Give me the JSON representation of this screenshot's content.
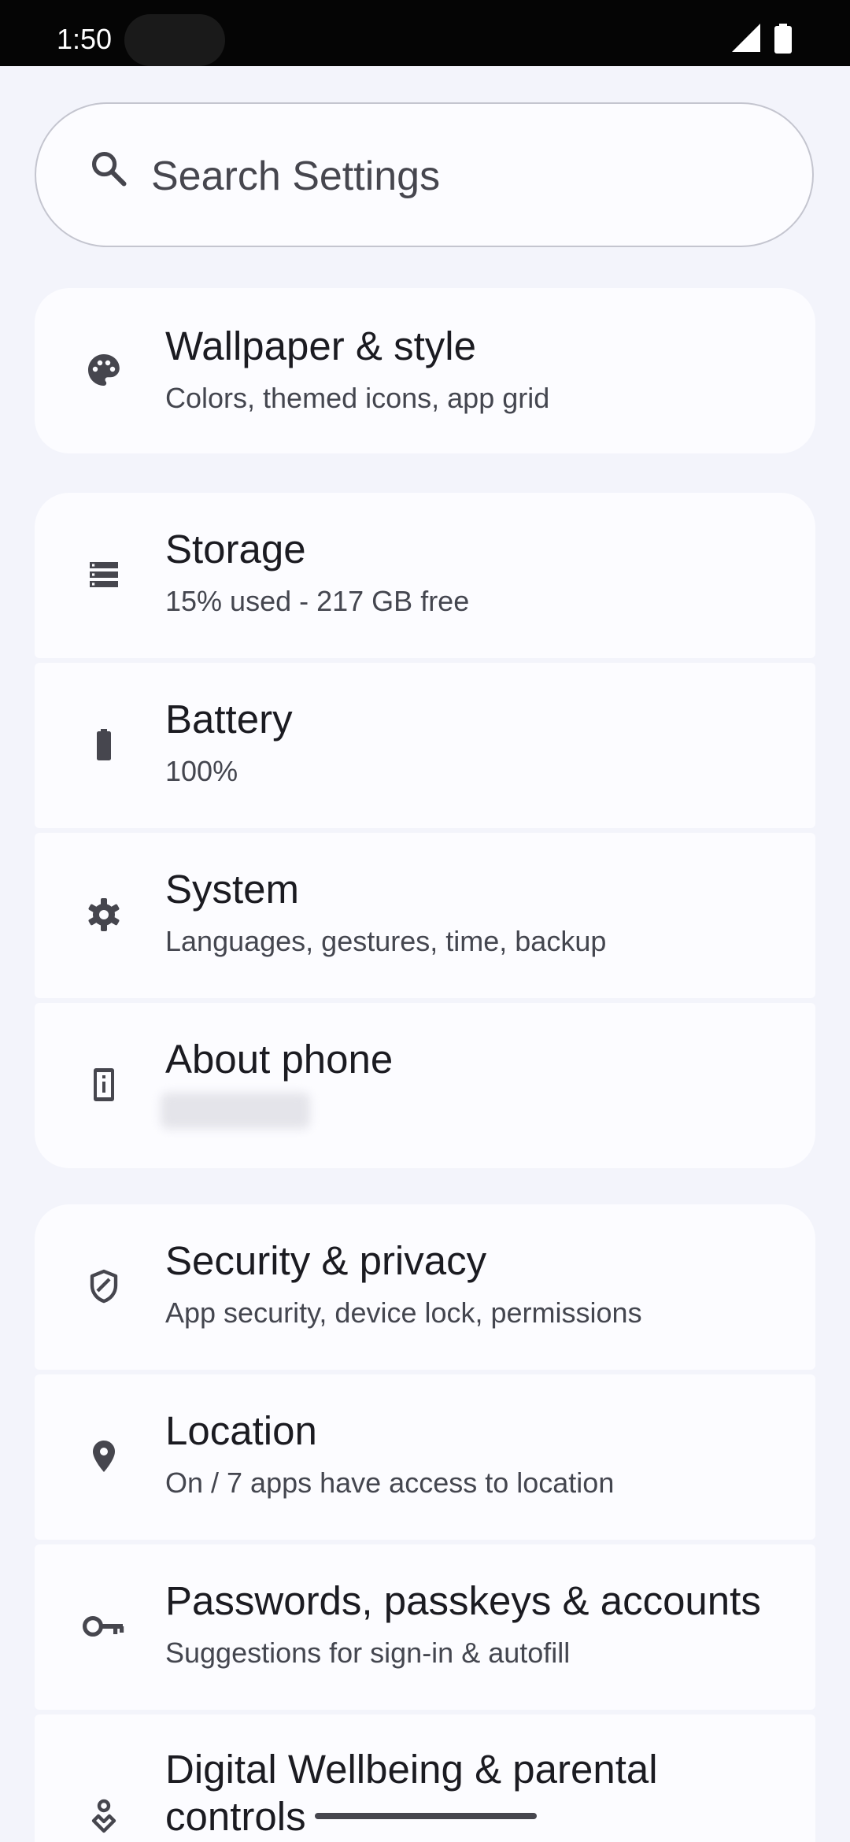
{
  "status_bar": {
    "time": "1:50",
    "icons": [
      "signal-icon",
      "battery-icon"
    ]
  },
  "search": {
    "placeholder": "Search Settings",
    "icon": "search-icon"
  },
  "items": [
    {
      "icon": "palette-icon",
      "title": "Wallpaper & style",
      "subtitle": "Colors, themed icons, app grid"
    },
    {
      "icon": "storage-icon",
      "title": "Storage",
      "subtitle": "15% used - 217 GB free"
    },
    {
      "icon": "battery-icon",
      "title": "Battery",
      "subtitle": "100%"
    },
    {
      "icon": "gear-icon",
      "title": "System",
      "subtitle": "Languages, gestures, time, backup"
    },
    {
      "icon": "phone-info-icon",
      "title": "About phone",
      "subtitle": ""
    },
    {
      "icon": "shield-icon",
      "title": "Security & privacy",
      "subtitle": "App security, device lock, permissions"
    },
    {
      "icon": "location-pin-icon",
      "title": "Location",
      "subtitle": "On / 7 apps have access to location"
    },
    {
      "icon": "key-icon",
      "title": "Passwords, passkeys & accounts",
      "subtitle": "Suggestions for sign-in & autofill"
    },
    {
      "icon": "wellbeing-icon",
      "title": "Digital Wellbeing & parental controls",
      "subtitle": ""
    }
  ],
  "colors": {
    "background": "#f3f4fb",
    "card": "#fcfcff",
    "icon": "#46464e",
    "status_bar": "#050505"
  }
}
